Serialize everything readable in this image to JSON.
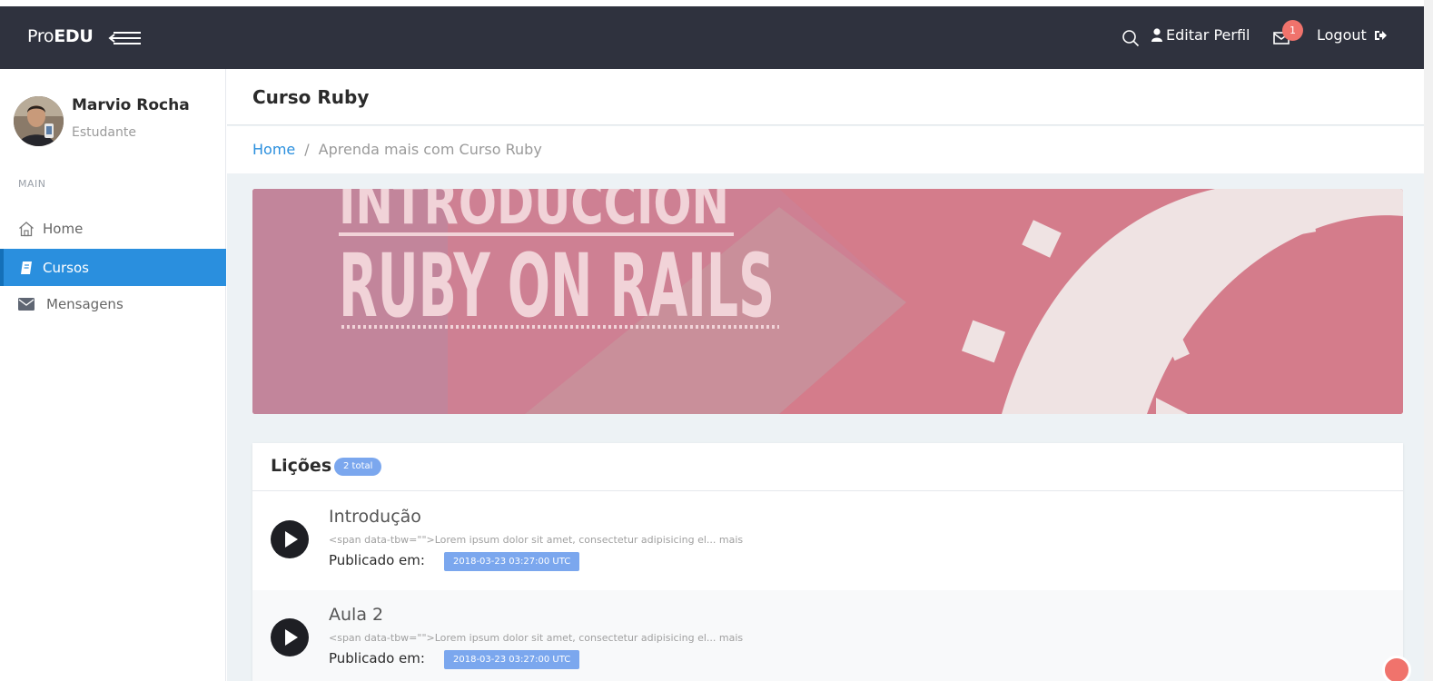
{
  "brand": {
    "prefix": "Pro",
    "bold": "EDU"
  },
  "header": {
    "profile_label": "Editar Perfil",
    "notification_count": "1",
    "logout_label": "Logout"
  },
  "user": {
    "name": "Marvio Rocha",
    "role": "Estudante"
  },
  "sidebar": {
    "section": "MAIN",
    "items": [
      {
        "label": "Home",
        "icon": "home-icon",
        "active": false
      },
      {
        "label": "Cursos",
        "icon": "book-icon",
        "active": true
      },
      {
        "label": "Mensagens",
        "icon": "envelope-icon",
        "active": false
      }
    ]
  },
  "page": {
    "title": "Curso Ruby",
    "breadcrumb": {
      "home": "Home",
      "separator": "/",
      "current": "Aprenda mais com Curso Ruby"
    }
  },
  "banner": {
    "line1": "INTRODUCCION",
    "line2": "RUBY ON RAILS"
  },
  "lessons": {
    "title": "Lições",
    "badge": "2 total",
    "items": [
      {
        "title": "Introdução",
        "description": "<span data-tbw=\"\">Lorem ipsum dolor sit amet, consectetur adipisicing el... mais",
        "published_label": "Publicado em:",
        "published_at": "2018-03-23 03:27:00 UTC"
      },
      {
        "title": "Aula 2",
        "description": "<span data-tbw=\"\">Lorem ipsum dolor sit amet, consectetur adipisicing el... mais",
        "published_label": "Publicado em:",
        "published_at": "2018-03-23 03:27:00 UTC"
      }
    ]
  },
  "colors": {
    "topbar": "#2f323e",
    "accent": "#2a8fde",
    "badge": "#7ba7ee",
    "notify": "#f0736c",
    "banner": "#d47c8b"
  }
}
